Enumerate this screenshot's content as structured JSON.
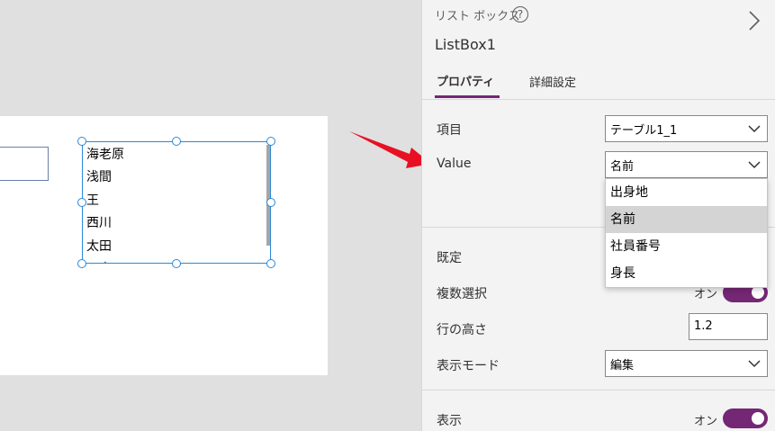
{
  "canvas": {
    "listbox": {
      "items": [
        "海老原",
        "浅間",
        "王",
        "西川",
        "太田",
        "田中"
      ]
    }
  },
  "panel": {
    "control_type": "リスト ボックス",
    "help_glyph": "?",
    "control_name": "ListBox1",
    "tabs": [
      {
        "label": "プロパティ",
        "active": true
      },
      {
        "label": "詳細設定",
        "active": false
      }
    ],
    "items": {
      "label": "項目",
      "value": "テーブル1_1"
    },
    "value": {
      "label": "Value",
      "selected": "名前",
      "options": [
        "出身地",
        "名前",
        "社員番号",
        "身長"
      ]
    },
    "default": {
      "label": "既定"
    },
    "multi_select": {
      "label": "複数選択",
      "state": "オン"
    },
    "line_height": {
      "label": "行の高さ",
      "value": "1.2"
    },
    "display_mode": {
      "label": "表示モード",
      "value": "編集"
    },
    "visible": {
      "label": "表示",
      "state": "オン"
    }
  },
  "colors": {
    "toggle_on": "#742774",
    "selection_border": "#2b88d8",
    "arrow": "#e81123"
  }
}
